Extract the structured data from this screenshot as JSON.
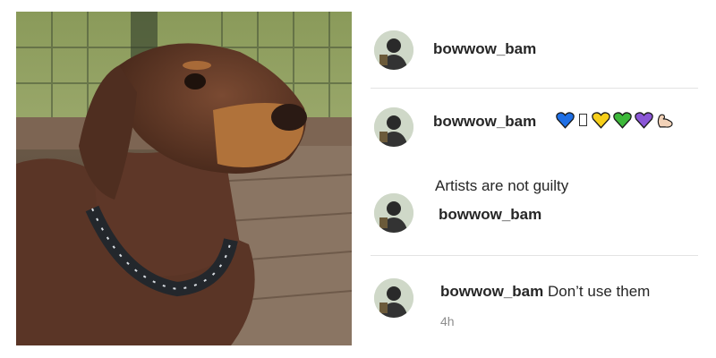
{
  "post": {
    "image_alt": "Doberman dog wearing a braided collar"
  },
  "comments": [
    {
      "username": "bowwow_bam",
      "text": ""
    },
    {
      "username": "bowwow_bam",
      "emojis": [
        "blue-heart-icon",
        "missing-glyph-icon",
        "yellow-heart-icon",
        "green-heart-icon",
        "purple-heart-icon",
        "flexed-biceps-icon"
      ],
      "text": "Artists are not guilty"
    },
    {
      "username": "bowwow_bam",
      "text": ""
    },
    {
      "username": "bowwow_bam",
      "text": "Don’t use them",
      "timestamp": "4h"
    }
  ],
  "colors": {
    "blue_heart": "#1f6fe5",
    "yellow_heart": "#f7cf1a",
    "green_heart": "#3db83a",
    "purple_heart": "#8a56d6",
    "muted_text": "#8e8e8e",
    "divider": "#e3e3e3"
  }
}
